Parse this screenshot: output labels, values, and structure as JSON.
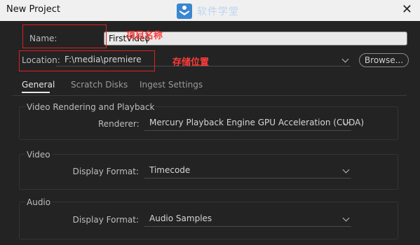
{
  "window": {
    "title": "New Project",
    "watermark_text": "软件学堂"
  },
  "name_field": {
    "label": "Name:",
    "value": "FirstVideo"
  },
  "location_field": {
    "label": "Location:",
    "value": "F:\\media\\premiere"
  },
  "browse_button": {
    "label": "Browse..."
  },
  "annotations": {
    "name_note": "项目名称",
    "location_note": "存储位置"
  },
  "tabs": [
    {
      "label": "General",
      "active": true
    },
    {
      "label": "Scratch Disks",
      "active": false
    },
    {
      "label": "Ingest Settings",
      "active": false
    }
  ],
  "sections": {
    "video_rendering": {
      "title": "Video Rendering and Playback",
      "renderer_label": "Renderer:",
      "renderer_value": "Mercury Playback Engine GPU Acceleration (CUDA)"
    },
    "video": {
      "title": "Video",
      "display_format_label": "Display Format:",
      "display_format_value": "Timecode"
    },
    "audio": {
      "title": "Audio",
      "display_format_label": "Display Format:",
      "display_format_value": "Audio Samples"
    }
  },
  "colors": {
    "annotation_red": "#e02020",
    "background": "#232323"
  }
}
